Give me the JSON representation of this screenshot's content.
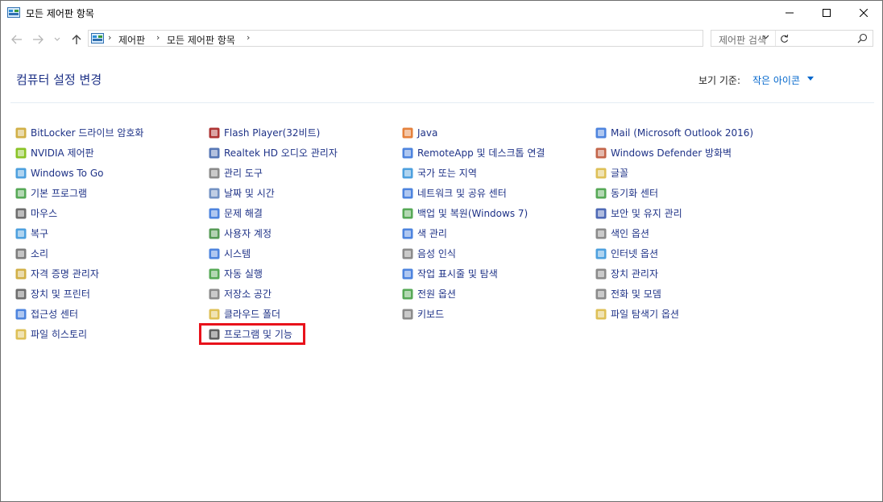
{
  "window": {
    "title": "모든 제어판 항목"
  },
  "address": {
    "crumbs": [
      "제어판",
      "모든 제어판 항목"
    ],
    "search_placeholder": "제어판 검색"
  },
  "header": {
    "title": "컴퓨터 설정 변경",
    "view_label": "보기 기준:",
    "view_value": "작은 아이콘"
  },
  "columns": [
    [
      {
        "label": "BitLocker 드라이브 암호화",
        "icon": "bitlocker-icon",
        "color": "#c9a227"
      },
      {
        "label": "NVIDIA 제어판",
        "icon": "nvidia-icon",
        "color": "#76b900"
      },
      {
        "label": "Windows To Go",
        "icon": "windows-to-go-icon",
        "color": "#2f8fd8"
      },
      {
        "label": "기본 프로그램",
        "icon": "default-programs-icon",
        "color": "#3a9a3a"
      },
      {
        "label": "마우스",
        "icon": "mouse-icon",
        "color": "#555555"
      },
      {
        "label": "복구",
        "icon": "recovery-icon",
        "color": "#2f8fd8"
      },
      {
        "label": "소리",
        "icon": "sound-icon",
        "color": "#666666"
      },
      {
        "label": "자격 증명 관리자",
        "icon": "credential-manager-icon",
        "color": "#c9a227"
      },
      {
        "label": "장치 및 프린터",
        "icon": "devices-printers-icon",
        "color": "#555555"
      },
      {
        "label": "접근성 센터",
        "icon": "ease-of-access-icon",
        "color": "#2f6fd8"
      },
      {
        "label": "파일 히스토리",
        "icon": "file-history-icon",
        "color": "#d8b53a"
      }
    ],
    [
      {
        "label": "Flash Player(32비트)",
        "icon": "flash-player-icon",
        "color": "#a01010"
      },
      {
        "label": "Realtek HD 오디오 관리자",
        "icon": "realtek-audio-icon",
        "color": "#3a5fa8"
      },
      {
        "label": "관리 도구",
        "icon": "admin-tools-icon",
        "color": "#777777"
      },
      {
        "label": "날짜 및 시간",
        "icon": "date-time-icon",
        "color": "#5a7fb8"
      },
      {
        "label": "문제 해결",
        "icon": "troubleshooting-icon",
        "color": "#2f6fd8"
      },
      {
        "label": "사용자 계정",
        "icon": "user-accounts-icon",
        "color": "#3a8a3a"
      },
      {
        "label": "시스템",
        "icon": "system-icon",
        "color": "#2f6fd8"
      },
      {
        "label": "자동 실행",
        "icon": "autoplay-icon",
        "color": "#3a9a3a"
      },
      {
        "label": "저장소 공간",
        "icon": "storage-spaces-icon",
        "color": "#777777"
      },
      {
        "label": "클라우드 폴더",
        "icon": "cloud-folder-icon",
        "color": "#d8b53a"
      },
      {
        "label": "프로그램 및 기능",
        "icon": "programs-features-icon",
        "color": "#444444"
      }
    ],
    [
      {
        "label": "Java",
        "icon": "java-icon",
        "color": "#e06b1a"
      },
      {
        "label": "RemoteApp 및 데스크톱 연결",
        "icon": "remoteapp-icon",
        "color": "#2f6fd8"
      },
      {
        "label": "국가 또는 지역",
        "icon": "region-icon",
        "color": "#2f8fd8"
      },
      {
        "label": "네트워크 및 공유 센터",
        "icon": "network-sharing-icon",
        "color": "#2f6fd8"
      },
      {
        "label": "백업 및 복원(Windows 7)",
        "icon": "backup-restore-icon",
        "color": "#3a9a3a"
      },
      {
        "label": "색 관리",
        "icon": "color-management-icon",
        "color": "#2f6fd8"
      },
      {
        "label": "음성 인식",
        "icon": "speech-recognition-icon",
        "color": "#777777"
      },
      {
        "label": "작업 표시줄 및 탐색",
        "icon": "taskbar-navigation-icon",
        "color": "#2f6fd8"
      },
      {
        "label": "전원 옵션",
        "icon": "power-options-icon",
        "color": "#3a9a3a"
      },
      {
        "label": "키보드",
        "icon": "keyboard-icon",
        "color": "#777777"
      }
    ],
    [
      {
        "label": "Mail (Microsoft Outlook 2016)",
        "icon": "mail-icon",
        "color": "#2f6fd8"
      },
      {
        "label": "Windows Defender 방화벽",
        "icon": "firewall-icon",
        "color": "#b84a2a"
      },
      {
        "label": "글꼴",
        "icon": "fonts-icon",
        "color": "#d8b53a"
      },
      {
        "label": "동기화 센터",
        "icon": "sync-center-icon",
        "color": "#3a9a3a"
      },
      {
        "label": "보안 및 유지 관리",
        "icon": "security-maintenance-icon",
        "color": "#2f4fa8"
      },
      {
        "label": "색인 옵션",
        "icon": "indexing-options-icon",
        "color": "#777777"
      },
      {
        "label": "인터넷 옵션",
        "icon": "internet-options-icon",
        "color": "#2f8fd8"
      },
      {
        "label": "장치 관리자",
        "icon": "device-manager-icon",
        "color": "#777777"
      },
      {
        "label": "전화 및 모뎀",
        "icon": "phone-modem-icon",
        "color": "#777777"
      },
      {
        "label": "파일 탐색기 옵션",
        "icon": "file-explorer-options-icon",
        "color": "#d8b53a"
      }
    ]
  ]
}
